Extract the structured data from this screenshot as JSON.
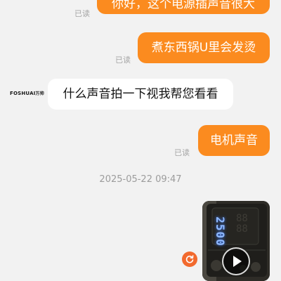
{
  "colors": {
    "outgoing_bubble": "#fb8b1f",
    "incoming_bubble": "#ffffff",
    "background": "#f2f2f2",
    "read_text": "#a6a6a6",
    "resend_button": "#f26a2e"
  },
  "messages": [
    {
      "direction": "out",
      "text": "你好，这个电源插声音很大",
      "status": "已读"
    },
    {
      "direction": "out",
      "text": "煮东西锅U里会发烫",
      "status": "已读"
    },
    {
      "direction": "in",
      "sender_logo": "FOSHUAI",
      "text": "什么声音拍一下视我帮您看看"
    },
    {
      "direction": "out",
      "text": "电机声音",
      "status": "已读"
    }
  ],
  "timestamp": "2025-05-22 09:47",
  "video_message": {
    "display_reading": "2500",
    "play_icon": "play-icon",
    "resend_icon": "refresh-icon"
  }
}
